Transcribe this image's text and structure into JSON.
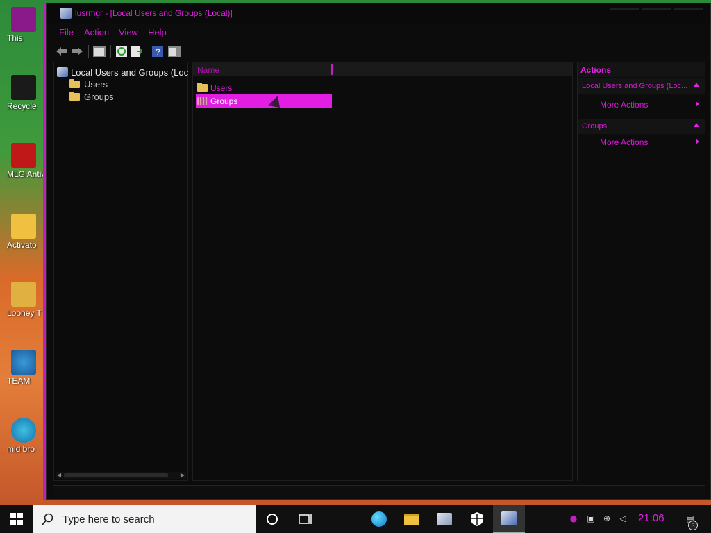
{
  "desktop": {
    "icons": [
      {
        "label": "This",
        "name": "this-pc"
      },
      {
        "label": "Recycle",
        "name": "recycle-bin"
      },
      {
        "label": "MLG Antivi",
        "name": "mlg-antivirus"
      },
      {
        "label": "Activato",
        "name": "activator"
      },
      {
        "label": "Looney T",
        "name": "looney-tunes"
      },
      {
        "label": "TEAM",
        "name": "team"
      },
      {
        "label": "mid bro",
        "name": "mid-browser"
      }
    ]
  },
  "window": {
    "title": "lusrmgr - [Local Users and Groups (Local)]",
    "menu": {
      "file": "File",
      "action": "Action",
      "view": "View",
      "help": "Help"
    },
    "tree": {
      "root": "Local Users and Groups (Loc",
      "nodes": [
        "Users",
        "Groups"
      ]
    },
    "list": {
      "column_name": "Name",
      "items": [
        {
          "label": "Users",
          "selected": false
        },
        {
          "label": "Groups",
          "selected": true
        }
      ]
    },
    "actions": {
      "header": "Actions",
      "section1": "Local Users and Groups (Loc...",
      "section1_link": "More Actions",
      "section2": "Groups",
      "section2_link": "More Actions"
    }
  },
  "taskbar": {
    "search_placeholder": "Type here to search",
    "clock": "21:06",
    "notification_count": "3"
  },
  "colors": {
    "accent": "#e11ee1",
    "background": "#0c0c0c"
  }
}
